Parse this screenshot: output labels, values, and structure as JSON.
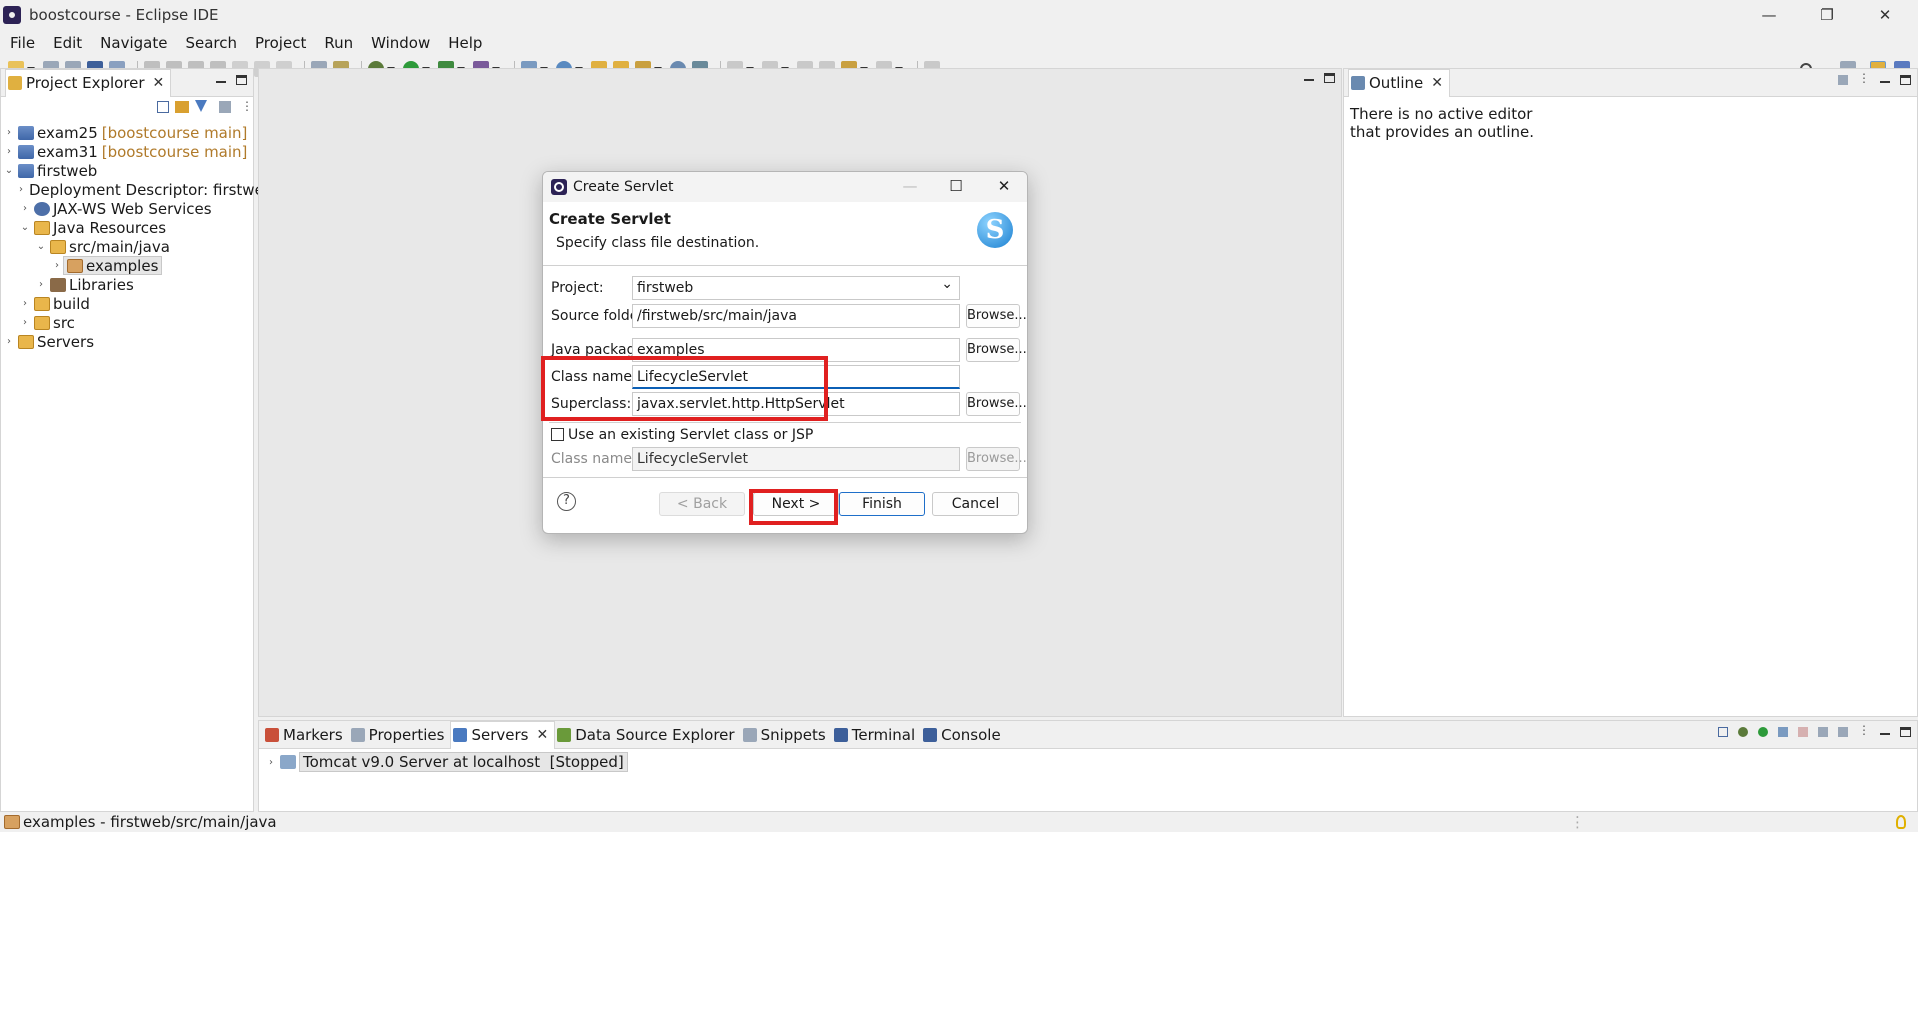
{
  "window": {
    "title": "boostcourse - Eclipse IDE",
    "minimize": "—",
    "restore": "❐",
    "close": "✕"
  },
  "menu": [
    "File",
    "Edit",
    "Navigate",
    "Search",
    "Project",
    "Run",
    "Window",
    "Help"
  ],
  "project_explorer": {
    "tab_label": "Project Explorer",
    "tree": [
      {
        "label": "exam25",
        "decoration": "[boostcourse main]",
        "depth": 0,
        "expanded": false
      },
      {
        "label": "exam31",
        "decoration": "[boostcourse main]",
        "depth": 0,
        "expanded": false
      },
      {
        "label": "firstweb",
        "decoration": "",
        "depth": 0,
        "expanded": true
      },
      {
        "label": "Deployment Descriptor: firstweb",
        "depth": 1,
        "expanded": false
      },
      {
        "label": "JAX-WS Web Services",
        "depth": 1,
        "expanded": false
      },
      {
        "label": "Java Resources",
        "depth": 1,
        "expanded": true
      },
      {
        "label": "src/main/java",
        "depth": 2,
        "expanded": true
      },
      {
        "label": "examples",
        "depth": 3,
        "expanded": false,
        "selected": true
      },
      {
        "label": "Libraries",
        "depth": 2,
        "expanded": false
      },
      {
        "label": "build",
        "depth": 1,
        "expanded": false
      },
      {
        "label": "src",
        "depth": 1,
        "expanded": false
      },
      {
        "label": "Servers",
        "depth": 0,
        "expanded": false
      }
    ]
  },
  "outline": {
    "tab_label": "Outline",
    "message": "There is no active editor that provides an outline."
  },
  "dialog": {
    "window_title": "Create Servlet",
    "header_title": "Create Servlet",
    "header_subtitle": "Specify class file destination.",
    "logo_letter": "S",
    "project_label": "Project:",
    "project_value": "firstweb",
    "source_folder_label": "Source folder:",
    "source_folder_value": "/firstweb/src/main/java",
    "java_package_label": "Java package:",
    "java_package_value": "examples",
    "class_name_label": "Class name:",
    "class_name_value": "LifecycleServlet",
    "superclass_label": "Superclass:",
    "superclass_value": "javax.servlet.http.HttpServlet",
    "browse_label": "Browse...",
    "use_existing_label": "Use an existing Servlet class or JSP",
    "use_existing_checked": false,
    "existing_class_label": "Class name:",
    "existing_class_value": "LifecycleServlet",
    "help_label": "?",
    "back_label": "< Back",
    "next_label": "Next >",
    "finish_label": "Finish",
    "cancel_label": "Cancel"
  },
  "bottom_panel": {
    "tabs": [
      "Markers",
      "Properties",
      "Servers",
      "Data Source Explorer",
      "Snippets",
      "Terminal",
      "Console"
    ],
    "active_tab": "Servers",
    "server_row": "Tomcat v9.0 Server at localhost  [Stopped]"
  },
  "status_bar": {
    "text": "examples - firstweb/src/main/java"
  },
  "colors": {
    "highlight_box": "#e02020",
    "focus": "#0b5fb5",
    "tree_decoration": "#b07a2a"
  }
}
